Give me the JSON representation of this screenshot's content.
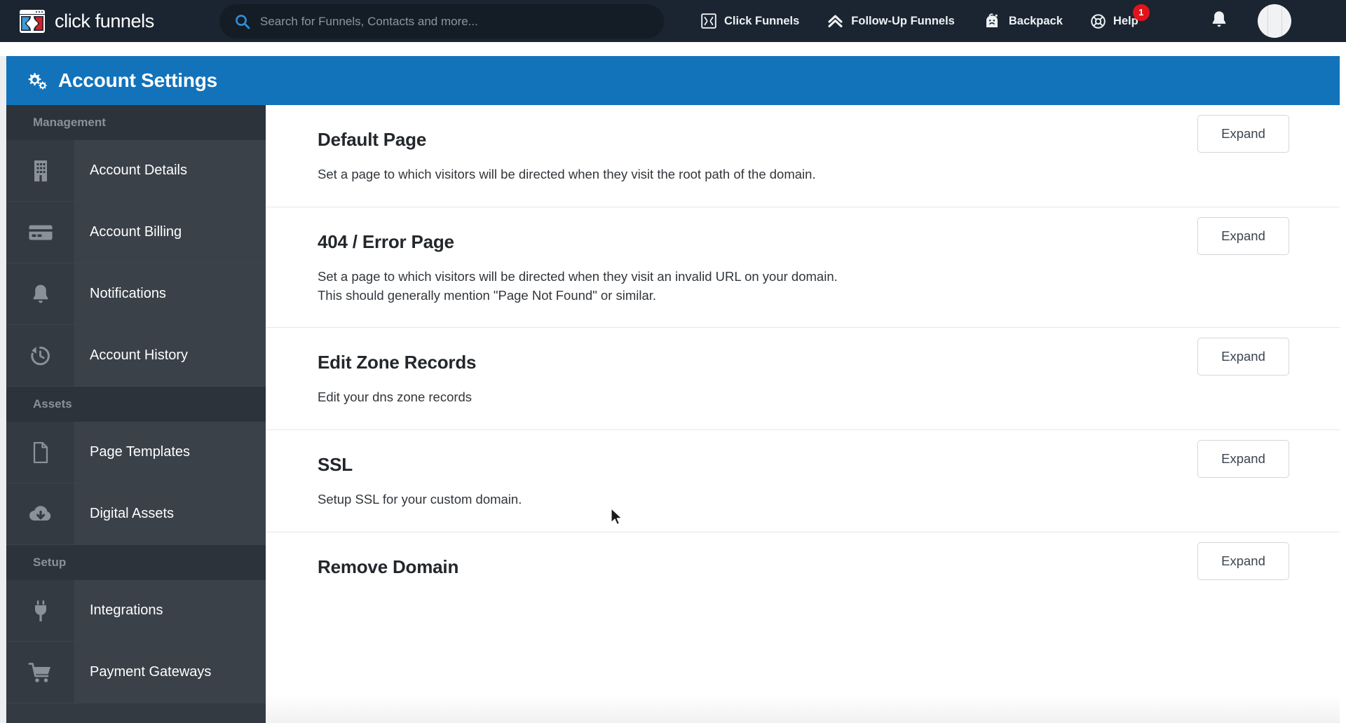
{
  "topnav": {
    "brand": "click funnels",
    "brand_logo_icon": "clickfunnels-logo-icon",
    "search": {
      "icon": "search-icon",
      "placeholder": "Search for Funnels, Contacts and more...",
      "value": ""
    },
    "items": [
      {
        "label": "Click Funnels",
        "icon": "click-funnels-icon"
      },
      {
        "label": "Follow-Up Funnels",
        "icon": "chevron-double-up-icon"
      },
      {
        "label": "Backpack",
        "icon": "backpack-icon"
      },
      {
        "label": "Help",
        "icon": "lifebuoy-icon",
        "badge": "1"
      }
    ],
    "bell_icon": "bell-icon",
    "avatar_icon": "user-avatar"
  },
  "page_header": {
    "title": "Account Settings",
    "icon": "gears-icon",
    "accent_color": "#1273bb"
  },
  "sidebar": {
    "groups": [
      {
        "label": "Management",
        "items": [
          {
            "label": "Account Details",
            "icon": "building-icon"
          },
          {
            "label": "Account Billing",
            "icon": "credit-card-icon"
          },
          {
            "label": "Notifications",
            "icon": "bell-icon"
          },
          {
            "label": "Account History",
            "icon": "history-clock-icon"
          }
        ]
      },
      {
        "label": "Assets",
        "items": [
          {
            "label": "Page Templates",
            "icon": "document-icon"
          },
          {
            "label": "Digital Assets",
            "icon": "cloud-download-icon"
          }
        ]
      },
      {
        "label": "Setup",
        "items": [
          {
            "label": "Integrations",
            "icon": "plug-icon"
          },
          {
            "label": "Payment Gateways",
            "icon": "shopping-cart-icon"
          }
        ]
      }
    ]
  },
  "main": {
    "expand_label": "Expand",
    "sections": [
      {
        "title": "Default Page",
        "description": "Set a page to which visitors will be directed when they visit the root path of the domain.",
        "description2": ""
      },
      {
        "title": "404 / Error Page",
        "description": "Set a page to which visitors will be directed when they visit an invalid URL on your domain.",
        "description2": "This should generally mention \"Page Not Found\" or similar."
      },
      {
        "title": "Edit Zone Records",
        "description": "Edit your dns zone records",
        "description2": ""
      },
      {
        "title": "SSL",
        "description": "Setup SSL for your custom domain.",
        "description2": ""
      },
      {
        "title": "Remove Domain",
        "description": "",
        "description2": ""
      }
    ]
  }
}
